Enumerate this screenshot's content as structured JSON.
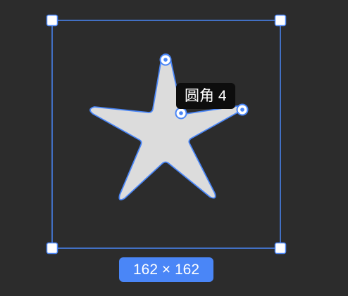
{
  "canvas": {
    "background": "#2c2c2c",
    "accent": "#4a86f7",
    "shape_fill": "#dcdcdc",
    "shape": "star",
    "selected": true
  },
  "corner_radius_tooltip": {
    "label": "圆角",
    "value": "4",
    "text": "圆角 4"
  },
  "dimension_badge": {
    "width": "162",
    "height": "162",
    "text": "162 × 162"
  }
}
